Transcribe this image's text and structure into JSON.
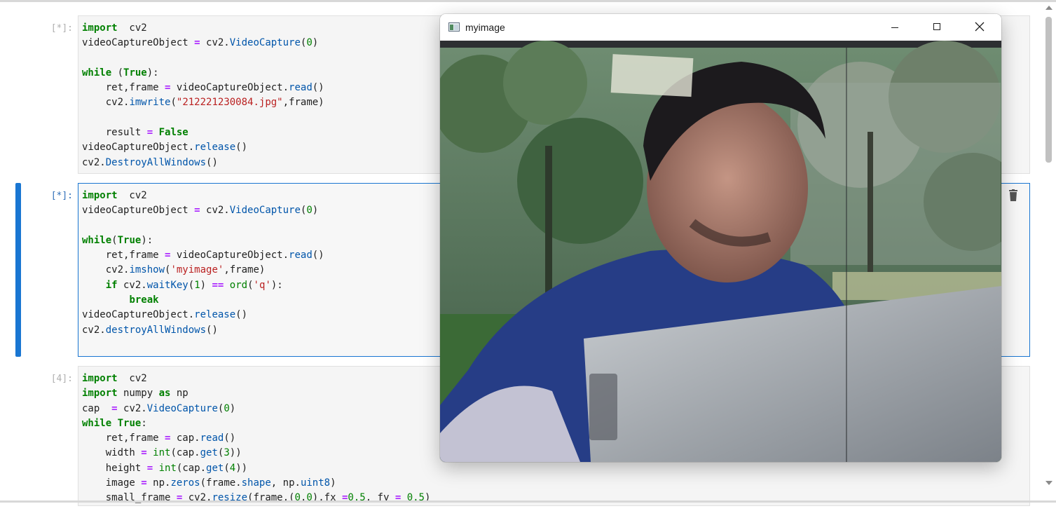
{
  "cells": [
    {
      "prompt": "[*]:",
      "lines": [
        [
          [
            "kw",
            "import"
          ],
          [
            "",
            "  cv2"
          ]
        ],
        [
          [
            "",
            "videoCaptureObject "
          ],
          [
            "kwo",
            "="
          ],
          [
            "",
            " cv2."
          ],
          [
            "fn",
            "VideoCapture"
          ],
          [
            "",
            "("
          ],
          [
            "num",
            "0"
          ],
          [
            "",
            ")"
          ]
        ],
        [],
        [
          [
            "kw",
            "while"
          ],
          [
            "",
            " ("
          ],
          [
            "kw",
            "True"
          ],
          [
            "",
            "):"
          ]
        ],
        [
          [
            "",
            "    ret,frame "
          ],
          [
            "kwo",
            "="
          ],
          [
            "",
            " videoCaptureObject."
          ],
          [
            "fn",
            "read"
          ],
          [
            "",
            "()"
          ]
        ],
        [
          [
            "",
            "    cv2."
          ],
          [
            "fn",
            "imwrite"
          ],
          [
            "",
            "("
          ],
          [
            "str",
            "\"212221230084.jpg\""
          ],
          [
            "",
            ",frame)"
          ]
        ],
        [],
        [
          [
            "",
            "    result "
          ],
          [
            "kwo",
            "="
          ],
          [
            "",
            " "
          ],
          [
            "kw",
            "False"
          ]
        ],
        [
          [
            "",
            "videoCaptureObject."
          ],
          [
            "fn",
            "release"
          ],
          [
            "",
            "()"
          ]
        ],
        [
          [
            "",
            "cv2."
          ],
          [
            "fn",
            "DestroyAllWindows"
          ],
          [
            "",
            "()"
          ]
        ]
      ]
    },
    {
      "prompt": "[*]:",
      "lines": [
        [
          [
            "kw",
            "import"
          ],
          [
            "",
            "  cv2"
          ]
        ],
        [
          [
            "",
            "videoCaptureObject "
          ],
          [
            "kwo",
            "="
          ],
          [
            "",
            " cv2."
          ],
          [
            "fn",
            "VideoCapture"
          ],
          [
            "",
            "("
          ],
          [
            "num",
            "0"
          ],
          [
            "",
            ")"
          ]
        ],
        [],
        [
          [
            "kw",
            "while"
          ],
          [
            "",
            "("
          ],
          [
            "kw",
            "True"
          ],
          [
            "",
            "):"
          ]
        ],
        [
          [
            "",
            "    ret,frame "
          ],
          [
            "kwo",
            "="
          ],
          [
            "",
            " videoCaptureObject."
          ],
          [
            "fn",
            "read"
          ],
          [
            "",
            "()"
          ]
        ],
        [
          [
            "",
            "    cv2."
          ],
          [
            "fn",
            "imshow"
          ],
          [
            "",
            "("
          ],
          [
            "str",
            "'myimage'"
          ],
          [
            "",
            ",frame)"
          ]
        ],
        [
          [
            "",
            "    "
          ],
          [
            "kw",
            "if"
          ],
          [
            "",
            " cv2."
          ],
          [
            "fn",
            "waitKey"
          ],
          [
            "",
            "("
          ],
          [
            "num",
            "1"
          ],
          [
            "",
            ") "
          ],
          [
            "kwo",
            "=="
          ],
          [
            "",
            " "
          ],
          [
            "bi",
            "ord"
          ],
          [
            "",
            "("
          ],
          [
            "str",
            "'q'"
          ],
          [
            "",
            "):"
          ]
        ],
        [
          [
            "",
            "        "
          ],
          [
            "kw",
            "break"
          ]
        ],
        [
          [
            "",
            "videoCaptureObject."
          ],
          [
            "fn",
            "release"
          ],
          [
            "",
            "()"
          ]
        ],
        [
          [
            "",
            "cv2."
          ],
          [
            "fn",
            "destroyAllWindows"
          ],
          [
            "",
            "()"
          ]
        ],
        []
      ]
    },
    {
      "prompt": "[4]:",
      "lines": [
        [
          [
            "kw",
            "import"
          ],
          [
            "",
            "  cv2"
          ]
        ],
        [
          [
            "kw",
            "import"
          ],
          [
            "",
            " numpy "
          ],
          [
            "kw",
            "as"
          ],
          [
            "",
            " np"
          ]
        ],
        [
          [
            "",
            "cap  "
          ],
          [
            "kwo",
            "="
          ],
          [
            "",
            " cv2."
          ],
          [
            "fn",
            "VideoCapture"
          ],
          [
            "",
            "("
          ],
          [
            "num",
            "0"
          ],
          [
            "",
            ")"
          ]
        ],
        [
          [
            "kw",
            "while"
          ],
          [
            "",
            " "
          ],
          [
            "kw",
            "True"
          ],
          [
            "",
            ":"
          ]
        ],
        [
          [
            "",
            "    ret,frame "
          ],
          [
            "kwo",
            "="
          ],
          [
            "",
            " cap."
          ],
          [
            "fn",
            "read"
          ],
          [
            "",
            "()"
          ]
        ],
        [
          [
            "",
            "    width "
          ],
          [
            "kwo",
            "="
          ],
          [
            "",
            " "
          ],
          [
            "bi",
            "int"
          ],
          [
            "",
            "(cap."
          ],
          [
            "fn",
            "get"
          ],
          [
            "",
            "("
          ],
          [
            "num",
            "3"
          ],
          [
            "",
            "))"
          ]
        ],
        [
          [
            "",
            "    height "
          ],
          [
            "kwo",
            "="
          ],
          [
            "",
            " "
          ],
          [
            "bi",
            "int"
          ],
          [
            "",
            "(cap."
          ],
          [
            "fn",
            "get"
          ],
          [
            "",
            "("
          ],
          [
            "num",
            "4"
          ],
          [
            "",
            "))"
          ]
        ],
        [
          [
            "",
            "    image "
          ],
          [
            "kwo",
            "="
          ],
          [
            "",
            " np."
          ],
          [
            "fn",
            "zeros"
          ],
          [
            "",
            "(frame."
          ],
          [
            "fn",
            "shape"
          ],
          [
            "",
            ", np."
          ],
          [
            "fn",
            "uint8"
          ],
          [
            "",
            ")"
          ]
        ],
        [
          [
            "",
            "    small_frame "
          ],
          [
            "kwo",
            "="
          ],
          [
            "",
            " cv2."
          ],
          [
            "fn",
            "resize"
          ],
          [
            "",
            "(frame,("
          ],
          [
            "num",
            "0"
          ],
          [
            "",
            ","
          ],
          [
            "num",
            "0"
          ],
          [
            "",
            "),fx "
          ],
          [
            "kwo",
            "="
          ],
          [
            "num",
            "0.5"
          ],
          [
            "",
            ", fy "
          ],
          [
            "kwo",
            "="
          ],
          [
            "",
            " "
          ],
          [
            "num",
            "0.5"
          ],
          [
            "",
            ")"
          ]
        ]
      ]
    }
  ],
  "window": {
    "title": "myimage",
    "icon": "app-window-icon",
    "buttons": [
      "minimize-icon",
      "maximize-icon",
      "close-icon"
    ]
  },
  "toolbar": {
    "delete_icon": "trash-icon"
  }
}
